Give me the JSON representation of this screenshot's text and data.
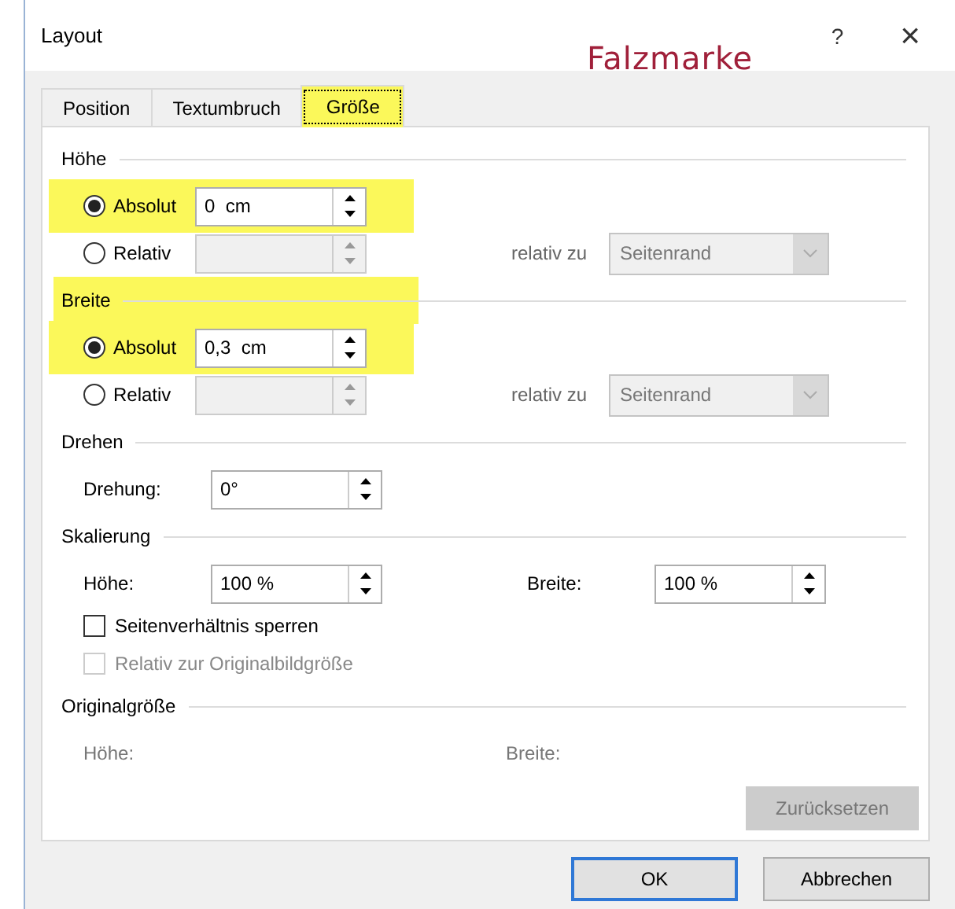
{
  "window": {
    "title": "Layout",
    "help": "?",
    "close": "×"
  },
  "annotation": {
    "text": "Falzmarke"
  },
  "tabs": [
    {
      "label": "Position",
      "selected": false,
      "highlighted": false
    },
    {
      "label": "Textumbruch",
      "selected": false,
      "highlighted": false
    },
    {
      "label": "Größe",
      "selected": true,
      "highlighted": true
    }
  ],
  "sections": [
    {
      "title": "Höhe",
      "highlighted": false,
      "rows": [
        {
          "kind": "radio",
          "label": "Absolut",
          "selected": true,
          "highlighted": true,
          "field": {
            "value": "0  cm",
            "disabled": false
          }
        },
        {
          "kind": "radio",
          "label": "Relativ",
          "selected": false,
          "highlighted": false,
          "field": {
            "disabled": true
          },
          "related": {
            "label": "relativ zu",
            "dropdown": "Seitenrand",
            "disabled": true
          }
        }
      ]
    },
    {
      "title": "Breite",
      "highlighted": true,
      "rows": [
        {
          "kind": "radio",
          "label": "Absolut",
          "selected": true,
          "highlighted": true,
          "field": {
            "value": "0,3  cm",
            "disabled": false
          }
        },
        {
          "kind": "radio",
          "label": "Relativ",
          "selected": false,
          "highlighted": false,
          "field": {
            "disabled": true
          },
          "related": {
            "label": "relativ zu",
            "dropdown": "Seitenrand",
            "disabled": true
          }
        }
      ]
    },
    {
      "title": "Drehen",
      "highlighted": false,
      "rows": [
        {
          "kind": "spin",
          "items": [
            {
              "label": "Drehung:",
              "value": "0°"
            }
          ]
        }
      ]
    },
    {
      "title": "Skalierung",
      "highlighted": false,
      "rows": [
        {
          "kind": "spin",
          "items": [
            {
              "label": "Höhe:",
              "value": "100 %"
            },
            {
              "label": "Breite:",
              "value": "100 %"
            }
          ]
        },
        {
          "kind": "checkbox",
          "label": "Seitenverhältnis sperren",
          "checked": false,
          "disabled": false
        },
        {
          "kind": "checkbox",
          "label": "Relativ zur Originalbildgröße",
          "checked": false,
          "disabled": true
        }
      ]
    },
    {
      "title": "Originalgröße",
      "highlighted": false,
      "rows": [
        {
          "kind": "info",
          "items": [
            {
              "label": "Höhe:"
            },
            {
              "label": "Breite:"
            }
          ]
        }
      ],
      "button": {
        "label": "Zurücksetzen",
        "disabled": true
      }
    }
  ],
  "buttons": [
    {
      "label": "OK",
      "default": true
    },
    {
      "label": "Abbrechen",
      "default": false
    }
  ]
}
